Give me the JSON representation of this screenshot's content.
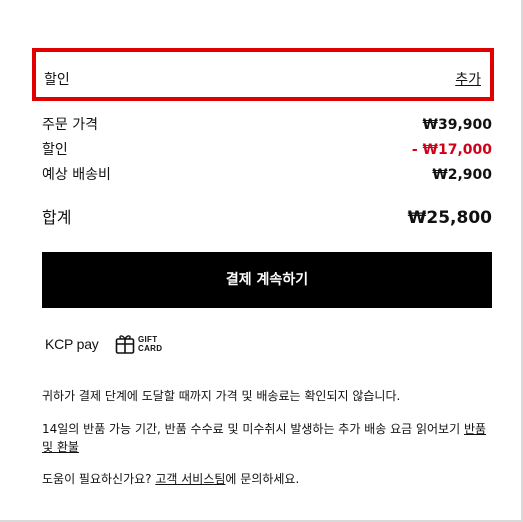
{
  "discount_section": {
    "label": "할인",
    "add_link": "추가"
  },
  "summary": {
    "order_price_label": "주문 가격",
    "order_price_value": "₩39,900",
    "discount_label": "할인",
    "discount_value": "- ₩17,000",
    "shipping_label": "예상 배송비",
    "shipping_value": "₩2,900"
  },
  "total": {
    "label": "합계",
    "value": "₩25,800"
  },
  "checkout_button": {
    "label": "결제 계속하기"
  },
  "payment_methods": {
    "kcp_logo_text": "KCP pay",
    "gift_card_line1": "GIFT",
    "gift_card_line2": "CARD"
  },
  "info": {
    "line1": "귀하가 결제 단계에 도달할 때까지 가격 및 배송료는 확인되지 않습니다.",
    "line2_text": "14일의 반품 가능 기간, 반품 수수료 및 미수취시 발생하는 추가 배송 요금 읽어보기 ",
    "line2_link": "반품 및 환불",
    "line3_before": "도움이 필요하신가요? ",
    "line3_link": "고객 서비스팀",
    "line3_after": "에 문의하세요."
  },
  "colors": {
    "highlight_border": "#e00000",
    "discount_value": "#d0021b",
    "button_background": "#000000",
    "button_text": "#ffffff"
  },
  "icons": {
    "gift_card": "gift-card-icon"
  }
}
